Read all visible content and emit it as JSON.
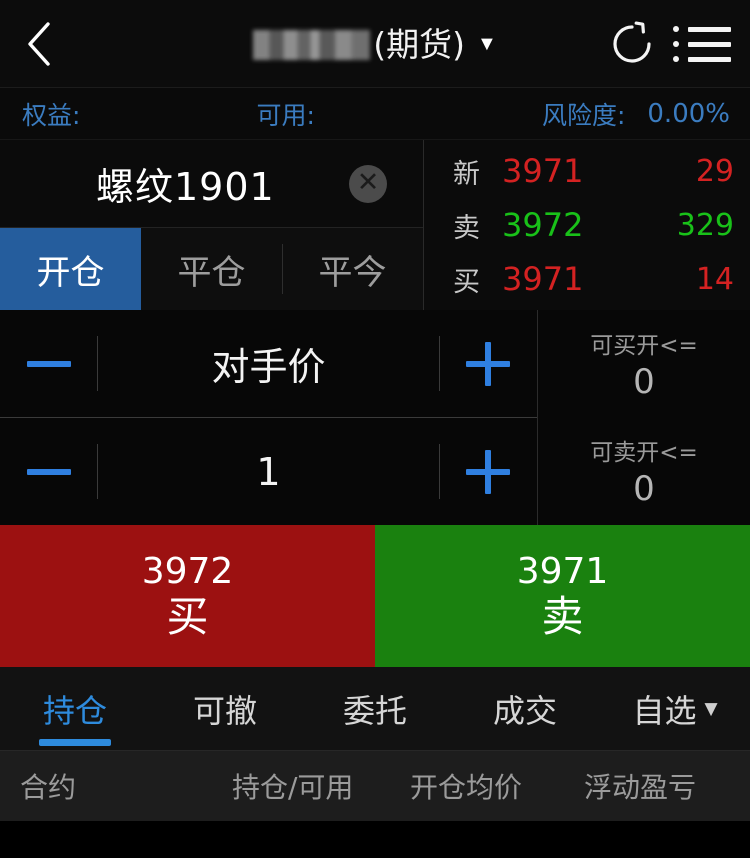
{
  "header": {
    "back_icon": "chevron-left-icon",
    "account_name_masked": "",
    "title_suffix": "(期货)",
    "dropdown_caret": "▼",
    "refresh_icon": "refresh-icon",
    "menu_icon": "list-menu-icon"
  },
  "account_strip": {
    "equity_label": "权益:",
    "equity_value_masked": "",
    "available_label": "可用:",
    "available_value_masked": "",
    "risk_label": "风险度:",
    "risk_value": "0.00%",
    "label_color": "#3b7cc0"
  },
  "contract": {
    "name": "螺纹1901",
    "clear_icon": "close-circle-icon"
  },
  "open_close_tabs": [
    {
      "label": "开仓",
      "active": true
    },
    {
      "label": "平仓",
      "active": false
    },
    {
      "label": "平今",
      "active": false
    }
  ],
  "quote": {
    "rows": [
      {
        "label": "新",
        "price": "3971",
        "volume": "29",
        "direction": "up"
      },
      {
        "label": "卖",
        "price": "3972",
        "volume": "329",
        "direction": "down"
      },
      {
        "label": "买",
        "price": "3971",
        "volume": "14",
        "direction": "up"
      }
    ],
    "up_color": "#d42222",
    "down_color": "#19c119"
  },
  "order": {
    "price_stepper": {
      "minus_label": "−",
      "value": "对手价",
      "plus_label": "+"
    },
    "qty_stepper": {
      "minus_label": "−",
      "value": "1",
      "plus_label": "+"
    },
    "limits": [
      {
        "label": "可买开<=",
        "value": "0"
      },
      {
        "label": "可卖开<=",
        "value": "0"
      }
    ]
  },
  "trade_buttons": {
    "buy": {
      "price": "3972",
      "label": "买",
      "color": "#9c1111"
    },
    "sell": {
      "price": "3971",
      "label": "卖",
      "color": "#1a810f"
    }
  },
  "bottom_tabs": [
    {
      "label": "持仓",
      "active": true
    },
    {
      "label": "可撤",
      "active": false
    },
    {
      "label": "委托",
      "active": false
    },
    {
      "label": "成交",
      "active": false
    },
    {
      "label": "自选",
      "active": false,
      "caret": "▼"
    }
  ],
  "table_headers": [
    "合约",
    "持仓/可用",
    "开仓均价",
    "浮动盈亏"
  ],
  "accent_color": "#2e8bdd",
  "tab_active_bg": "#255d9d"
}
